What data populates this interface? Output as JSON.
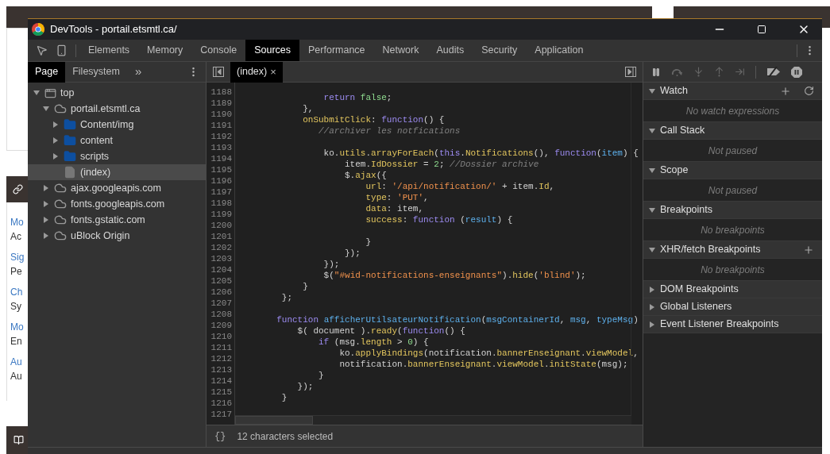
{
  "background_page": {
    "fragments": [
      {
        "text": "Mo",
        "kind": "label"
      },
      {
        "text": "Ac",
        "kind": "value"
      },
      {
        "text": "Sig",
        "kind": "label"
      },
      {
        "text": "Pe",
        "kind": "value"
      },
      {
        "text": "Ch",
        "kind": "label"
      },
      {
        "text": "Sy",
        "kind": "value"
      },
      {
        "text": "Mo",
        "kind": "label"
      },
      {
        "text": "En",
        "kind": "value"
      },
      {
        "text": "Au",
        "kind": "label"
      },
      {
        "text": "Au",
        "kind": "value"
      }
    ]
  },
  "window": {
    "title": "DevTools - portail.etsmtl.ca/"
  },
  "panel_tabs": [
    {
      "label": "Elements",
      "selected": false
    },
    {
      "label": "Memory",
      "selected": false
    },
    {
      "label": "Console",
      "selected": false
    },
    {
      "label": "Sources",
      "selected": true
    },
    {
      "label": "Performance",
      "selected": false
    },
    {
      "label": "Network",
      "selected": false
    },
    {
      "label": "Audits",
      "selected": false
    },
    {
      "label": "Security",
      "selected": false
    },
    {
      "label": "Application",
      "selected": false
    }
  ],
  "navigator": {
    "tabs": [
      {
        "label": "Page",
        "selected": true
      },
      {
        "label": "Filesystem",
        "selected": false
      }
    ],
    "more": "»",
    "tree": [
      {
        "label": "top",
        "kind": "frame",
        "expanded": true,
        "selected": false,
        "children": [
          {
            "label": "portail.etsmtl.ca",
            "kind": "domain",
            "expanded": true,
            "selected": false,
            "children": [
              {
                "label": "Content/img",
                "kind": "folder",
                "expanded": false,
                "selected": false
              },
              {
                "label": "content",
                "kind": "folder",
                "expanded": false,
                "selected": false
              },
              {
                "label": "scripts",
                "kind": "folder",
                "expanded": false,
                "selected": false
              },
              {
                "label": "(index)",
                "kind": "file",
                "selected": true
              }
            ]
          },
          {
            "label": "ajax.googleapis.com",
            "kind": "domain",
            "expanded": false,
            "selected": false
          },
          {
            "label": "fonts.googleapis.com",
            "kind": "domain",
            "expanded": false,
            "selected": false
          },
          {
            "label": "fonts.gstatic.com",
            "kind": "domain",
            "expanded": false,
            "selected": false
          },
          {
            "label": "uBlock Origin",
            "kind": "domain",
            "expanded": false,
            "selected": false
          }
        ]
      }
    ]
  },
  "editor": {
    "tabs": [
      {
        "label": "(index)",
        "selected": true,
        "close": "×"
      }
    ],
    "lines": [
      {
        "n": "1188",
        "seg": [
          {
            "text": "                return",
            "kind": "keyword"
          },
          {
            "text": " false",
            "kind": "number"
          },
          {
            "text": ";",
            "kind": "plain"
          }
        ]
      },
      {
        "n": "1189",
        "seg": [
          {
            "text": "            },",
            "kind": "plain"
          }
        ]
      },
      {
        "n": "1190",
        "seg": [
          {
            "text": "            onSubmitClick",
            "kind": "property"
          },
          {
            "text": ": ",
            "kind": "plain"
          },
          {
            "text": "function",
            "kind": "keyword"
          },
          {
            "text": "() {",
            "kind": "plain"
          }
        ]
      },
      {
        "n": "1191",
        "seg": [
          {
            "text": "               //archiver les notfications",
            "kind": "comment"
          }
        ]
      },
      {
        "n": "1192"
      },
      {
        "n": "1193",
        "seg": [
          {
            "text": "                ko.",
            "kind": "plain"
          },
          {
            "text": "utils",
            "kind": "property"
          },
          {
            "text": ".",
            "kind": "plain"
          },
          {
            "text": "arrayForEach",
            "kind": "property"
          },
          {
            "text": "(",
            "kind": "plain"
          },
          {
            "text": "this",
            "kind": "keyword"
          },
          {
            "text": ".",
            "kind": "plain"
          },
          {
            "text": "Notifications",
            "kind": "property"
          },
          {
            "text": "(), ",
            "kind": "plain"
          },
          {
            "text": "function",
            "kind": "keyword"
          },
          {
            "text": "(",
            "kind": "plain"
          },
          {
            "text": "item",
            "kind": "param"
          },
          {
            "text": ") {",
            "kind": "plain"
          }
        ]
      },
      {
        "n": "1194",
        "seg": [
          {
            "text": "                    item.",
            "kind": "plain"
          },
          {
            "text": "IdDossier",
            "kind": "property"
          },
          {
            "text": " = ",
            "kind": "plain"
          },
          {
            "text": "2",
            "kind": "number"
          },
          {
            "text": "; ",
            "kind": "plain"
          },
          {
            "text": "//Dossier archive",
            "kind": "comment"
          }
        ]
      },
      {
        "n": "1195",
        "seg": [
          {
            "text": "                    $.",
            "kind": "plain"
          },
          {
            "text": "ajax",
            "kind": "property"
          },
          {
            "text": "({",
            "kind": "plain"
          }
        ]
      },
      {
        "n": "1196",
        "seg": [
          {
            "text": "                        url",
            "kind": "property"
          },
          {
            "text": ": ",
            "kind": "plain"
          },
          {
            "text": "'/api/notification/'",
            "kind": "string"
          },
          {
            "text": " + item.",
            "kind": "plain"
          },
          {
            "text": "Id",
            "kind": "property"
          },
          {
            "text": ",",
            "kind": "plain"
          }
        ]
      },
      {
        "n": "1197",
        "seg": [
          {
            "text": "                        type",
            "kind": "property"
          },
          {
            "text": ": ",
            "kind": "plain"
          },
          {
            "text": "'PUT'",
            "kind": "string"
          },
          {
            "text": ",",
            "kind": "plain"
          }
        ]
      },
      {
        "n": "1198",
        "seg": [
          {
            "text": "                        data",
            "kind": "property"
          },
          {
            "text": ": item,",
            "kind": "plain"
          }
        ]
      },
      {
        "n": "1199",
        "seg": [
          {
            "text": "                        success",
            "kind": "property"
          },
          {
            "text": ": ",
            "kind": "plain"
          },
          {
            "text": "function",
            "kind": "keyword"
          },
          {
            "text": " (",
            "kind": "plain"
          },
          {
            "text": "result",
            "kind": "param"
          },
          {
            "text": ") {",
            "kind": "plain"
          }
        ]
      },
      {
        "n": "1200"
      },
      {
        "n": "1201",
        "seg": [
          {
            "text": "                        }",
            "kind": "plain"
          }
        ]
      },
      {
        "n": "1202",
        "seg": [
          {
            "text": "                    });",
            "kind": "plain"
          }
        ]
      },
      {
        "n": "1203",
        "seg": [
          {
            "text": "                });",
            "kind": "plain"
          }
        ]
      },
      {
        "n": "1204",
        "seg": [
          {
            "text": "                $(",
            "kind": "plain"
          },
          {
            "text": "\"#wid-notifications-enseignants\"",
            "kind": "string"
          },
          {
            "text": ").",
            "kind": "plain"
          },
          {
            "text": "hide",
            "kind": "property"
          },
          {
            "text": "(",
            "kind": "plain"
          },
          {
            "text": "'blind'",
            "kind": "string"
          },
          {
            "text": ");",
            "kind": "plain"
          }
        ]
      },
      {
        "n": "1205",
        "seg": [
          {
            "text": "            }",
            "kind": "plain"
          }
        ]
      },
      {
        "n": "1206",
        "seg": [
          {
            "text": "        };",
            "kind": "plain"
          }
        ]
      },
      {
        "n": "1207"
      },
      {
        "n": "1208",
        "seg": [
          {
            "text": "       function",
            "kind": "keyword"
          },
          {
            "text": " afficherUtilsateurNotification",
            "kind": "param"
          },
          {
            "text": "(",
            "kind": "plain"
          },
          {
            "text": "msgContainerId",
            "kind": "param"
          },
          {
            "text": ", ",
            "kind": "plain"
          },
          {
            "text": "msg",
            "kind": "param"
          },
          {
            "text": ", ",
            "kind": "plain"
          },
          {
            "text": "typeMsg",
            "kind": "param"
          },
          {
            "text": ")",
            "kind": "plain"
          }
        ]
      },
      {
        "n": "1209",
        "seg": [
          {
            "text": "           $( document ).",
            "kind": "plain"
          },
          {
            "text": "ready",
            "kind": "property"
          },
          {
            "text": "(",
            "kind": "plain"
          },
          {
            "text": "function",
            "kind": "keyword"
          },
          {
            "text": "() {",
            "kind": "plain"
          }
        ]
      },
      {
        "n": "1210",
        "seg": [
          {
            "text": "               if",
            "kind": "keyword"
          },
          {
            "text": " (msg.",
            "kind": "plain"
          },
          {
            "text": "length",
            "kind": "property"
          },
          {
            "text": " > ",
            "kind": "plain"
          },
          {
            "text": "0",
            "kind": "number"
          },
          {
            "text": ") {",
            "kind": "plain"
          }
        ]
      },
      {
        "n": "1211",
        "seg": [
          {
            "text": "                   ko.",
            "kind": "plain"
          },
          {
            "text": "applyBindings",
            "kind": "property"
          },
          {
            "text": "(notification.",
            "kind": "plain"
          },
          {
            "text": "bannerEnseignant",
            "kind": "property"
          },
          {
            "text": ".",
            "kind": "plain"
          },
          {
            "text": "viewModel",
            "kind": "property"
          },
          {
            "text": ",",
            "kind": "plain"
          }
        ]
      },
      {
        "n": "1212",
        "seg": [
          {
            "text": "                   notification.",
            "kind": "plain"
          },
          {
            "text": "bannerEnseignant",
            "kind": "property"
          },
          {
            "text": ".",
            "kind": "plain"
          },
          {
            "text": "viewModel",
            "kind": "property"
          },
          {
            "text": ".",
            "kind": "plain"
          },
          {
            "text": "initState",
            "kind": "property"
          },
          {
            "text": "(msg);",
            "kind": "plain"
          }
        ]
      },
      {
        "n": "1213",
        "seg": [
          {
            "text": "               }",
            "kind": "plain"
          }
        ]
      },
      {
        "n": "1214",
        "seg": [
          {
            "text": "           });",
            "kind": "plain"
          }
        ]
      },
      {
        "n": "1215",
        "seg": [
          {
            "text": "        }",
            "kind": "plain"
          }
        ]
      },
      {
        "n": "1216"
      },
      {
        "n": "1217"
      }
    ],
    "status": {
      "format_icon": "{}",
      "text": "12 characters selected"
    }
  },
  "debugger": {
    "sections": [
      {
        "title": "Watch",
        "expanded": true,
        "can_add": true,
        "can_refresh": true,
        "message": "No watch expressions"
      },
      {
        "title": "Call Stack",
        "expanded": true,
        "message": "Not paused"
      },
      {
        "title": "Scope",
        "expanded": true,
        "message": "Not paused"
      },
      {
        "title": "Breakpoints",
        "expanded": true,
        "message": "No breakpoints"
      },
      {
        "title": "XHR/fetch Breakpoints",
        "expanded": true,
        "can_add": true,
        "message": "No breakpoints"
      },
      {
        "title": "DOM Breakpoints",
        "expanded": false
      },
      {
        "title": "Global Listeners",
        "expanded": false
      },
      {
        "title": "Event Listener Breakpoints",
        "expanded": false
      }
    ]
  }
}
